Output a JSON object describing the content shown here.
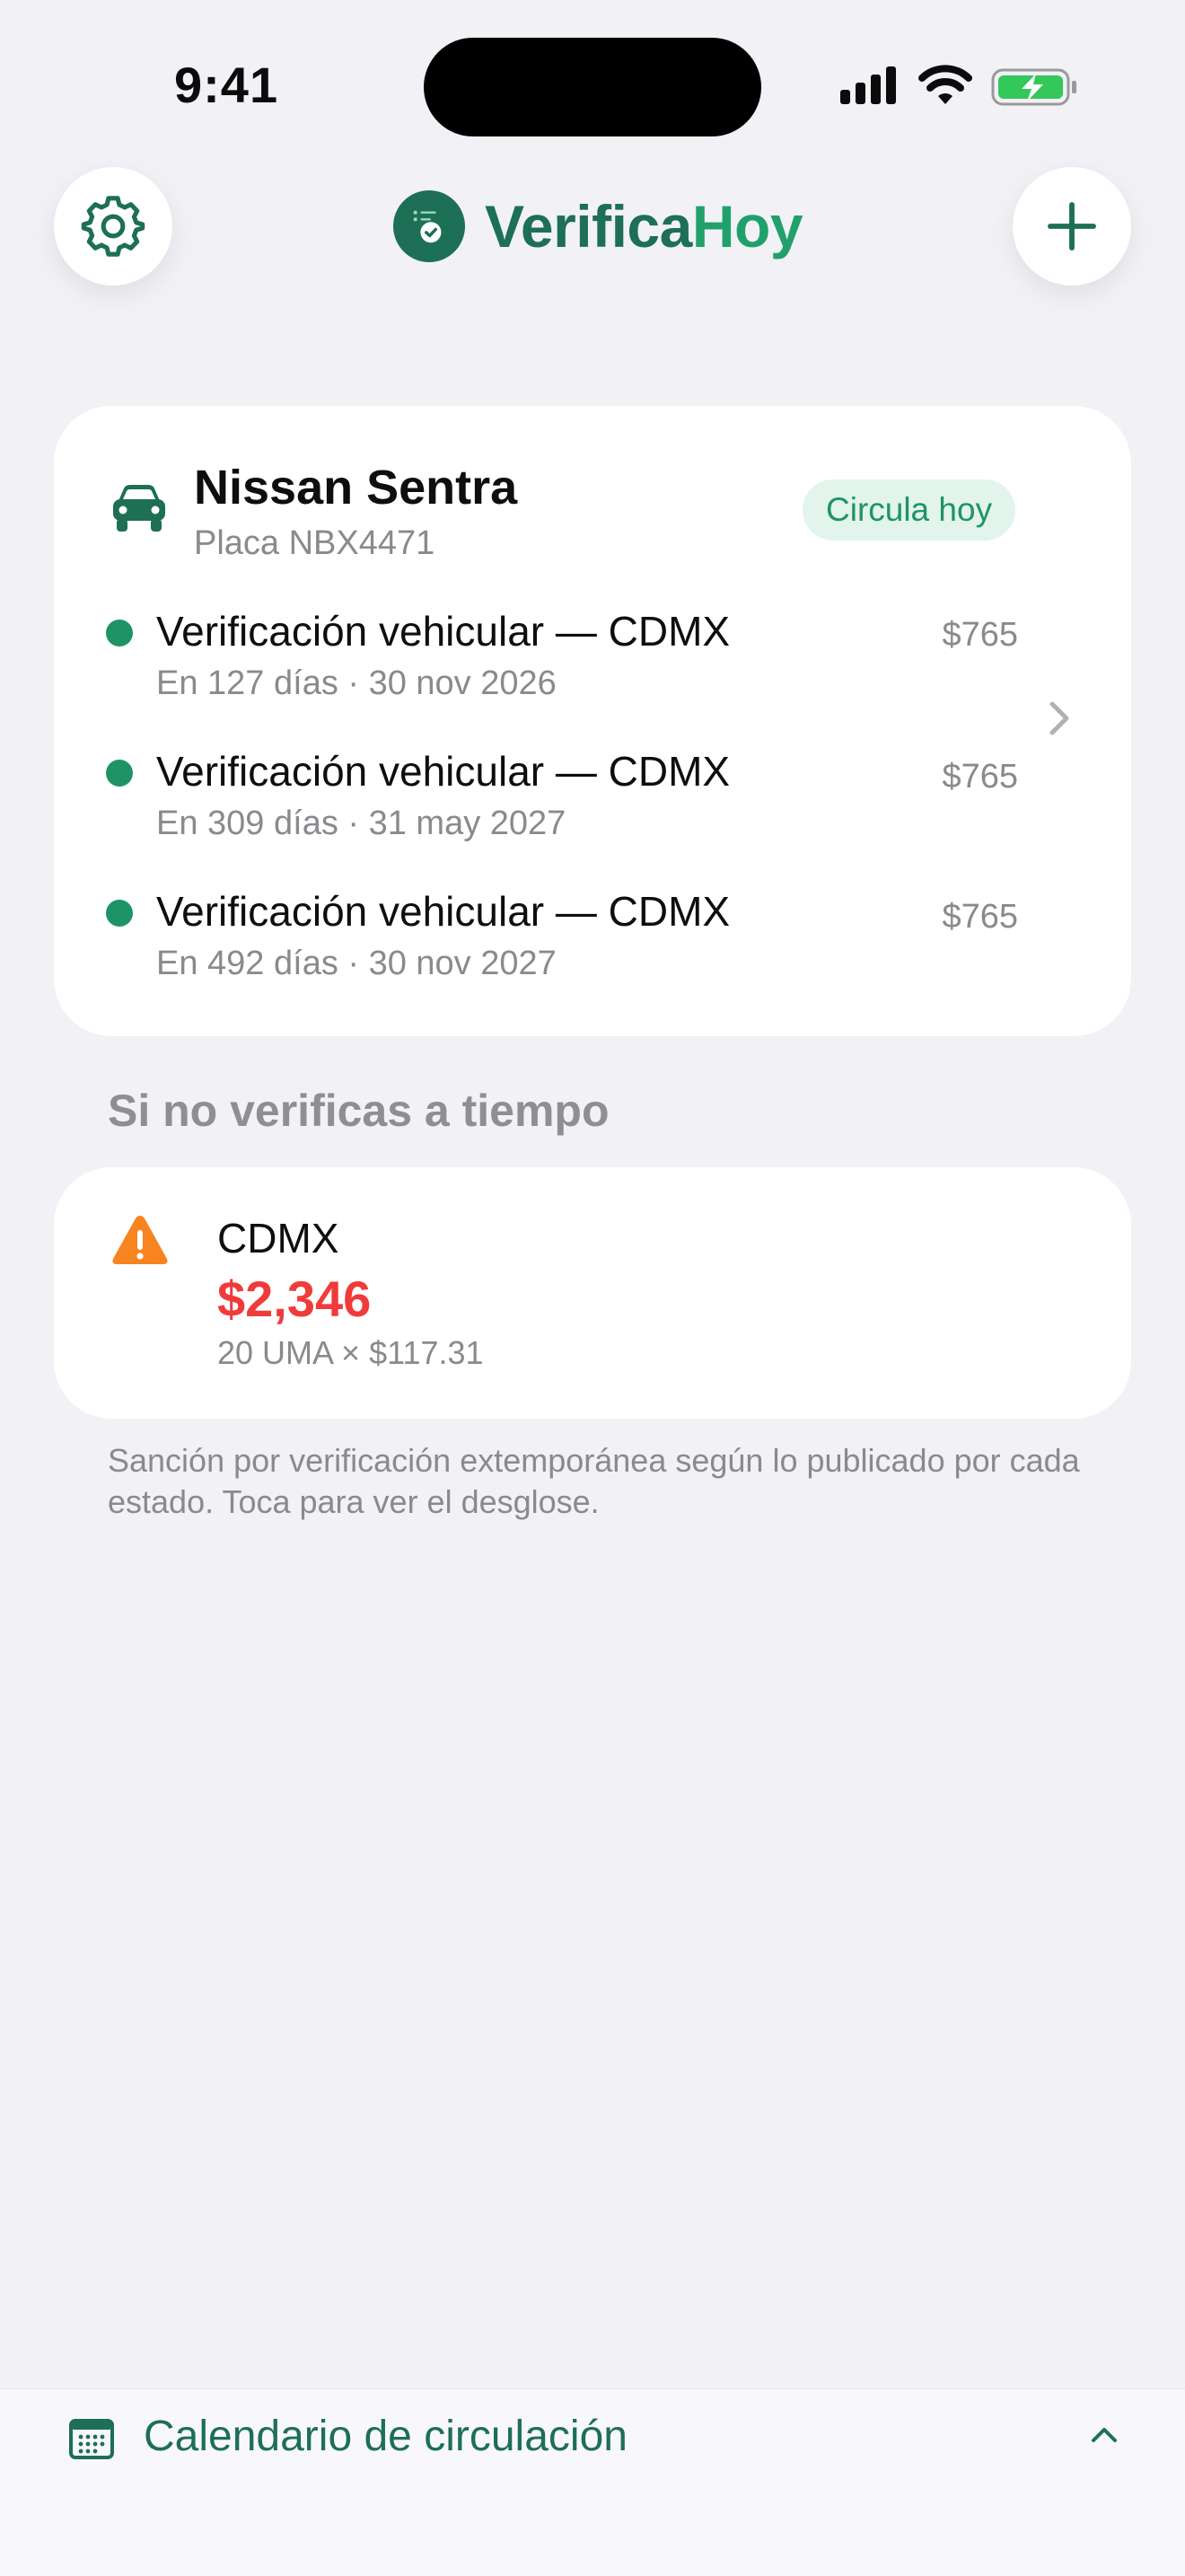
{
  "status_bar": {
    "time": "9:41"
  },
  "header": {
    "settings_icon": "gear-icon",
    "add_icon": "plus-icon",
    "logo_part1": "Verifica",
    "logo_part2": "Hoy"
  },
  "vehicle": {
    "name": "Nissan Sentra",
    "plate": "Placa NBX4471",
    "status": "Circula hoy",
    "events": [
      {
        "title": "Verificación vehicular — CDMX",
        "subtitle": "En 127 días · 30 nov 2026",
        "price": "$765"
      },
      {
        "title": "Verificación vehicular — CDMX",
        "subtitle": "En 309 días · 31 may 2027",
        "price": "$765"
      },
      {
        "title": "Verificación vehicular — CDMX",
        "subtitle": "En 492 días · 30 nov 2027",
        "price": "$765"
      }
    ]
  },
  "fines": {
    "section_title": "Si no verificas a tiempo",
    "state": "CDMX",
    "amount": "$2,346",
    "calculation": "20 UMA × $117.31",
    "footnote": "Sanción por verificación extemporánea según lo publicado por cada estado. Toca para ver el desglose."
  },
  "bottom_sheet": {
    "label": "Calendario de circulación"
  },
  "colors": {
    "brand_dark": "#1D6F55",
    "brand_light": "#22A06B",
    "status_green": "#1E9466",
    "fine_red": "#F03B3B",
    "warning_orange": "#F7841E"
  }
}
